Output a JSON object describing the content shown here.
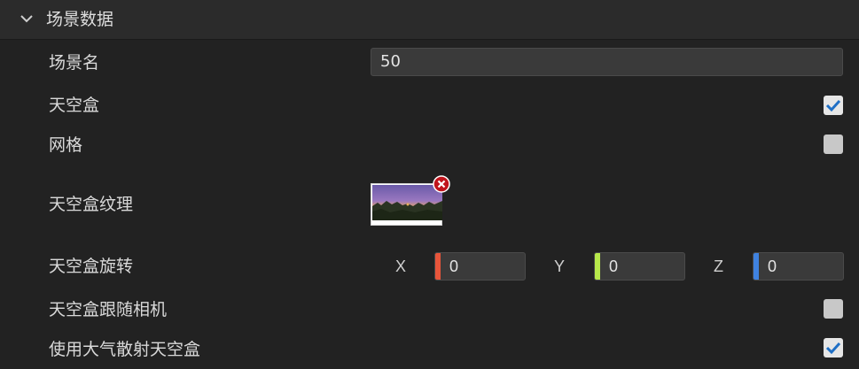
{
  "section": {
    "title": "场景数据",
    "icon": "chevron-down-icon"
  },
  "rows": {
    "scene_name": {
      "label": "场景名",
      "value": "50"
    },
    "skybox": {
      "label": "天空盒",
      "checked": true
    },
    "grid": {
      "label": "网格",
      "checked": false
    },
    "skybox_texture": {
      "label": "天空盒纹理",
      "remove_icon": "close-circle-icon"
    },
    "skybox_rotation": {
      "label": "天空盒旋转",
      "x": {
        "axis": "X",
        "value": "0",
        "color": "#e8553a"
      },
      "y": {
        "axis": "Y",
        "value": "0",
        "color": "#b7e84a"
      },
      "z": {
        "axis": "Z",
        "value": "0",
        "color": "#3f82e0"
      }
    },
    "skybox_follow_camera": {
      "label": "天空盒跟随相机",
      "checked": false
    },
    "atmospheric_skybox": {
      "label": "使用大气散射天空盒",
      "checked": true
    }
  },
  "colors": {
    "background": "#222222",
    "header": "#2b2b2b",
    "input": "#3a3a3a",
    "check_accent": "#1f6fc5",
    "remove_red": "#c0141c"
  }
}
